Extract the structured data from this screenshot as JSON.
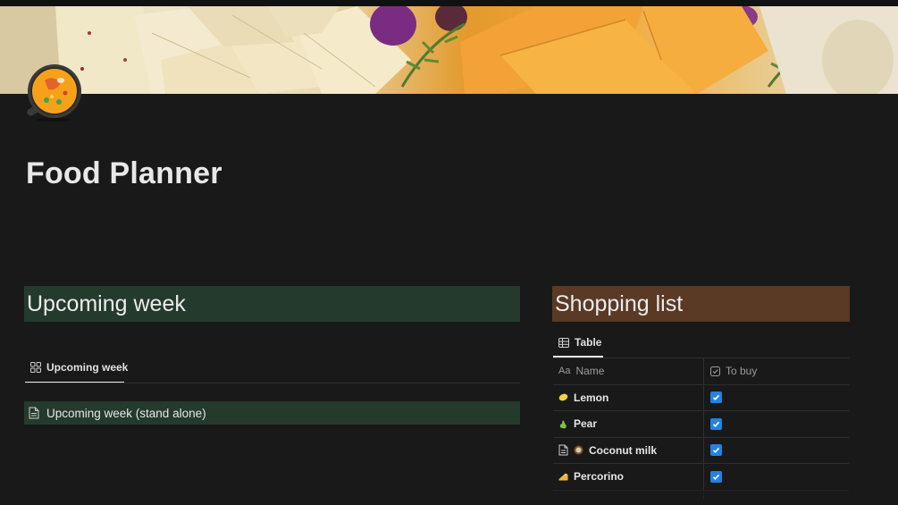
{
  "page": {
    "title": "Food Planner",
    "icon": "shallow-pan-of-food-icon"
  },
  "upcoming": {
    "heading": "Upcoming week",
    "view_tab": {
      "label": "Upcoming week",
      "icon": "gallery-grid-icon"
    },
    "linked_page": {
      "label": "Upcoming week (stand alone)",
      "icon": "page-document-icon"
    }
  },
  "shopping": {
    "heading": "Shopping list",
    "view_tab": {
      "label": "Table",
      "icon": "table-icon"
    },
    "columns": [
      {
        "label": "Name",
        "icon": "Aa"
      },
      {
        "label": "To buy",
        "icon": "checkbox-property-icon"
      }
    ],
    "rows": [
      {
        "name": "Lemon",
        "icon": "lemon-icon",
        "to_buy": true
      },
      {
        "name": "Pear",
        "icon": "pear-icon",
        "to_buy": true
      },
      {
        "name": "Coconut milk",
        "icon": "coconut-icon",
        "to_buy": true,
        "page_icon": true
      },
      {
        "name": "Percorino",
        "icon": "cheese-icon",
        "to_buy": true
      }
    ]
  },
  "colors": {
    "background": "#191919",
    "green_block": "#243a2d",
    "brown_block": "#5a3a24",
    "checkbox": "#2383e2"
  }
}
